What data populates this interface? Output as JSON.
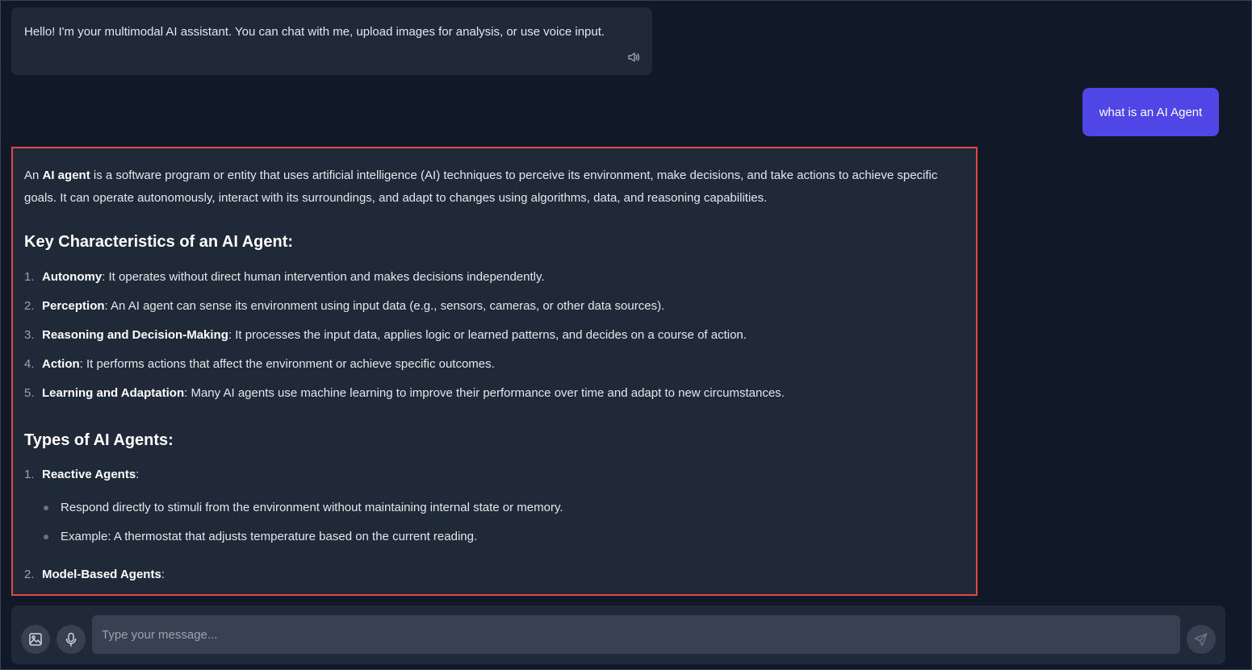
{
  "greeting": {
    "text": "Hello! I'm your multimodal AI assistant. You can chat with me, upload images for analysis, or use voice input.",
    "speaker_icon": "speaker-icon"
  },
  "user_message": {
    "text": "what is an AI Agent"
  },
  "answer": {
    "intro_prefix": "An ",
    "intro_bold": "AI agent",
    "intro_rest": " is a software program or entity that uses artificial intelligence (AI) techniques to perceive its environment, make decisions, and take actions to achieve specific goals. It can operate autonomously, interact with its surroundings, and adapt to changes using algorithms, data, and reasoning capabilities.",
    "heading1": "Key Characteristics of an AI Agent:",
    "characteristics": [
      {
        "num": "1.",
        "term": "Autonomy",
        "desc": ": It operates without direct human intervention and makes decisions independently."
      },
      {
        "num": "2.",
        "term": "Perception",
        "desc": ": An AI agent can sense its environment using input data (e.g., sensors, cameras, or other data sources)."
      },
      {
        "num": "3.",
        "term": "Reasoning and Decision-Making",
        "desc": ": It processes the input data, applies logic or learned patterns, and decides on a course of action."
      },
      {
        "num": "4.",
        "term": "Action",
        "desc": ": It performs actions that affect the environment or achieve specific outcomes."
      },
      {
        "num": "5.",
        "term": "Learning and Adaptation",
        "desc": ": Many AI agents use machine learning to improve their performance over time and adapt to new circumstances."
      }
    ],
    "heading2": "Types of AI Agents:",
    "types": [
      {
        "num": "1.",
        "term": "Reactive Agents",
        "suffix": ":",
        "bullets": [
          "Respond directly to stimuli from the environment without maintaining internal state or memory.",
          "Example: A thermostat that adjusts temperature based on the current reading."
        ]
      },
      {
        "num": "2.",
        "term": "Model-Based Agents",
        "suffix": ":",
        "bullets": []
      }
    ]
  },
  "input_bar": {
    "placeholder": "Type your message...",
    "value": "",
    "image_icon": "image-upload-icon",
    "mic_icon": "microphone-icon",
    "send_icon": "send-icon"
  },
  "colors": {
    "background": "#111827",
    "bubble": "#1f2937",
    "user_bubble": "#4f46e5",
    "highlight_border": "#e04848"
  }
}
